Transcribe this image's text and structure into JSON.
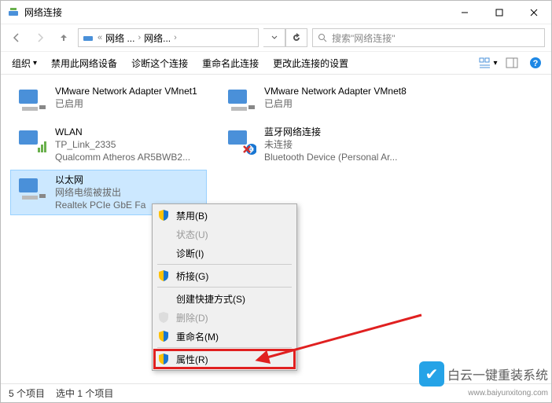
{
  "window": {
    "title": "网络连接"
  },
  "breadcrumb": {
    "c1": "网络 ...",
    "c2": "网络..."
  },
  "search": {
    "placeholder": "搜索\"网络连接\""
  },
  "toolbar": {
    "organize": "组织",
    "disable": "禁用此网络设备",
    "diagnose": "诊断这个连接",
    "rename": "重命名此连接",
    "settings": "更改此连接的设置"
  },
  "adapters": [
    {
      "name": "VMware Network Adapter VMnet1",
      "sub1": "已启用",
      "sub2": ""
    },
    {
      "name": "VMware Network Adapter VMnet8",
      "sub1": "已启用",
      "sub2": ""
    },
    {
      "name": "WLAN",
      "sub1": "TP_Link_2335",
      "sub2": "Qualcomm Atheros AR5BWB2..."
    },
    {
      "name": "蓝牙网络连接",
      "sub1": "未连接",
      "sub2": "Bluetooth Device (Personal Ar..."
    },
    {
      "name": "以太网",
      "sub1": "网络电缆被拔出",
      "sub2": "Realtek PCIe GbE Fa"
    }
  ],
  "ctx": {
    "disable": "禁用(B)",
    "status": "状态(U)",
    "diagnose": "诊断(I)",
    "bridge": "桥接(G)",
    "shortcut": "创建快捷方式(S)",
    "delete": "删除(D)",
    "rename": "重命名(M)",
    "properties": "属性(R)"
  },
  "status": {
    "count": "5 个项目",
    "selected": "选中 1 个项目"
  },
  "watermark": {
    "text": "白云一键重装系统",
    "url": "www.baiyunxitong.com"
  }
}
